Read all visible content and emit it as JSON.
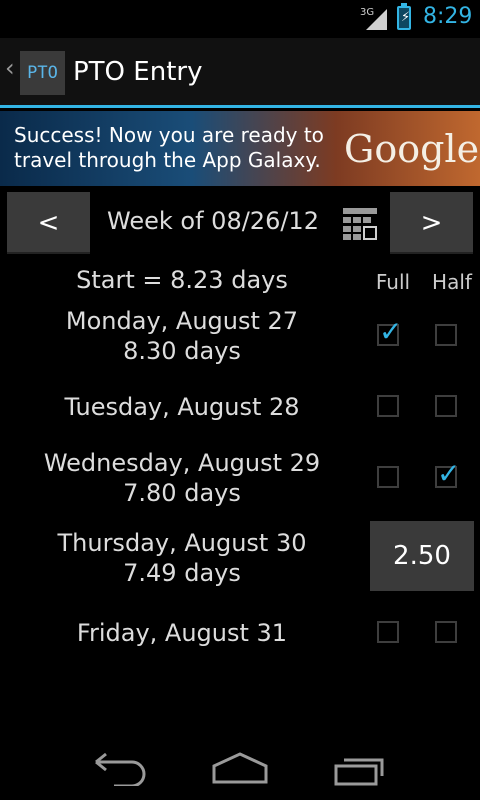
{
  "status_bar": {
    "network": "3G",
    "time": "8:29"
  },
  "action_bar": {
    "icon_text": "PTO",
    "title": "PTO Entry"
  },
  "ad_banner": {
    "text": "Success! Now you are ready to travel through the App Galaxy.",
    "logo_text": "Google"
  },
  "week_nav": {
    "prev_label": "<",
    "next_label": ">",
    "week_label": "Week of 08/26/12"
  },
  "header": {
    "start_label": "Start = 8.23 days",
    "full_label": "Full",
    "half_label": "Half"
  },
  "days": [
    {
      "label": "Monday, August 27",
      "subtext": "8.30 days",
      "full": true,
      "half": false
    },
    {
      "label": "Tuesday, August 28",
      "subtext": "",
      "full": false,
      "half": false
    },
    {
      "label": "Wednesday, August 29",
      "subtext": "7.80 days",
      "full": false,
      "half": true
    },
    {
      "label": "Thursday, August 30",
      "subtext": "7.49 days",
      "hours_value": "2.50"
    },
    {
      "label": "Friday, August 31",
      "subtext": "",
      "full": false,
      "half": false
    }
  ],
  "colors": {
    "accent": "#33b5e5",
    "background": "#000000",
    "button": "#3a3a3a"
  },
  "icons": {
    "back": "back-arrow-icon",
    "home": "home-icon",
    "recents": "recent-apps-icon",
    "calendar": "calendar-icon"
  }
}
